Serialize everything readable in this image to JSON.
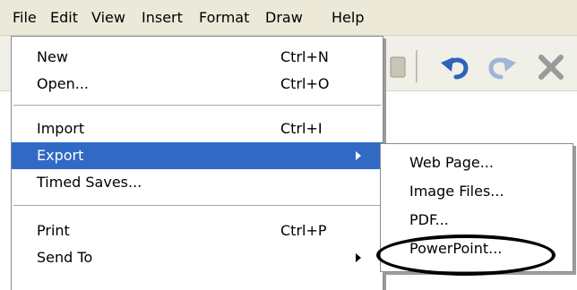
{
  "menubar": {
    "items": [
      "File",
      "Edit",
      "View",
      "Insert",
      "Format",
      "Draw",
      "Help"
    ]
  },
  "toolbar": {
    "icons": [
      "undo-icon",
      "redo-icon",
      "delete-icon"
    ]
  },
  "file_menu": {
    "items": [
      {
        "label": "New",
        "shortcut": "Ctrl+N"
      },
      {
        "label": "Open...",
        "shortcut": "Ctrl+O"
      },
      {
        "label": "Import",
        "shortcut": "Ctrl+I"
      },
      {
        "label": "Export",
        "shortcut": "",
        "submenu": true,
        "selected": true
      },
      {
        "label": "Timed Saves...",
        "shortcut": ""
      },
      {
        "label": "Print",
        "shortcut": "Ctrl+P"
      },
      {
        "label": "Send To",
        "shortcut": "",
        "submenu": true
      }
    ]
  },
  "export_submenu": {
    "items": [
      "Web Page...",
      "Image Files...",
      "PDF...",
      "PowerPoint..."
    ]
  },
  "colors": {
    "menubar_bg": "#ece9d8",
    "highlight": "#316ac5",
    "annotation": "#000000"
  }
}
